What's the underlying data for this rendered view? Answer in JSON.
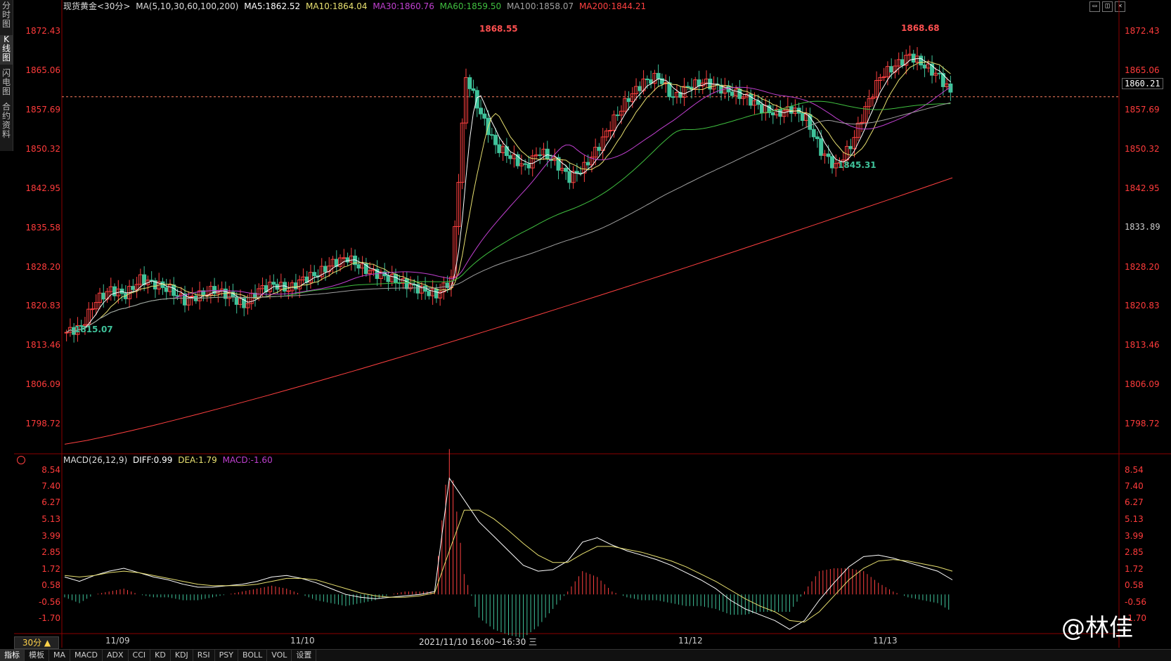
{
  "side_tabs": [
    {
      "label": "分时图"
    },
    {
      "label": "K线图",
      "active": true
    },
    {
      "label": "闪电图"
    },
    {
      "label": "合约资料"
    }
  ],
  "legend": {
    "symbol": "现货黄金<30分>",
    "ma_params": "MA(5,10,30,60,100,200)",
    "ma5": "MA5:1862.52",
    "ma10": "MA10:1864.04",
    "ma30": "MA30:1860.76",
    "ma60": "MA60:1859.50",
    "ma100": "MA100:1858.07",
    "ma200": "MA200:1844.21"
  },
  "colors": {
    "up": "#ff4040",
    "down": "#3fc29a",
    "ma5": "#ffffff",
    "ma10": "#e8e070",
    "ma30": "#c040d0",
    "ma60": "#40c040",
    "ma100": "#a0a0a0",
    "ma200": "#ff4040",
    "axis": "#ff3b3b",
    "grid": "#8b0000"
  },
  "price_axis": {
    "ticks": [
      "1872.43",
      "1865.06",
      "1857.69",
      "1850.32",
      "1842.95",
      "1835.58",
      "1828.20",
      "1820.83",
      "1813.46",
      "1806.09",
      "1798.72"
    ],
    "min": 1794,
    "max": 1876
  },
  "current_price": "1860.21",
  "cursor_price": "1833.89",
  "annotations": {
    "high1": "1868.55",
    "high2": "1868.68",
    "low1": "1815.07",
    "low2": "1845.31"
  },
  "macd": {
    "label": "MACD(26,12,9)",
    "diff": "DIFF:0.99",
    "dea": "DEA:1.79",
    "macd": "MACD:-1.60",
    "ticks": [
      "8.54",
      "7.40",
      "6.27",
      "5.13",
      "3.99",
      "2.85",
      "1.72",
      "0.58",
      "-0.56",
      "-1.70"
    ],
    "min": -2.6,
    "max": 9.0
  },
  "dates": {
    "d1": "11/09",
    "d2": "11/10",
    "cursor": "2021/11/10 16:00~16:30 三",
    "d3": "11/12",
    "d4": "11/13"
  },
  "period": "30分 ▲",
  "bottom_tabs": [
    "指标",
    "模板",
    "MA",
    "MACD",
    "ADX",
    "CCI",
    "KD",
    "KDJ",
    "RSI",
    "PSY",
    "BOLL",
    "VOL",
    "设置"
  ],
  "watermark": "@林佳",
  "chart_data": {
    "type": "candlestick",
    "series": [
      {
        "name": "MA5"
      },
      {
        "name": "MA10"
      },
      {
        "name": "MA30"
      },
      {
        "name": "MA60"
      },
      {
        "name": "MA100"
      },
      {
        "name": "MA200"
      }
    ],
    "ylim": [
      1794,
      1876
    ],
    "close_path": [
      1816,
      1817,
      1822,
      1824,
      1823,
      1826,
      1825,
      1824,
      1822,
      1823,
      1824,
      1823,
      1821,
      1824,
      1825,
      1824,
      1826,
      1827,
      1829,
      1830,
      1828,
      1827,
      1826,
      1825,
      1824,
      1823,
      1826,
      1864,
      1857,
      1851,
      1849,
      1847,
      1850,
      1848,
      1845,
      1847,
      1851,
      1856,
      1860,
      1863,
      1864,
      1860,
      1862,
      1863,
      1862,
      1861,
      1860,
      1858,
      1857,
      1858,
      1856,
      1850,
      1847,
      1851,
      1858,
      1864,
      1866,
      1868,
      1866,
      1864,
      1860
    ],
    "macd_path": [
      1.2,
      0.9,
      1.3,
      1.6,
      1.8,
      1.5,
      1.2,
      1.0,
      0.7,
      0.5,
      0.5,
      0.6,
      0.7,
      0.9,
      1.2,
      1.3,
      1.1,
      0.8,
      0.4,
      0.0,
      -0.2,
      -0.3,
      -0.2,
      -0.1,
      0.0,
      0.2,
      8.0,
      6.5,
      5.0,
      4.0,
      3.0,
      2.0,
      1.6,
      1.7,
      2.3,
      3.6,
      3.9,
      3.4,
      3.0,
      2.7,
      2.4,
      2.0,
      1.5,
      1.0,
      0.4,
      -0.4,
      -1.0,
      -1.4,
      -1.8,
      -2.4,
      -1.8,
      -0.4,
      0.8,
      1.9,
      2.6,
      2.7,
      2.5,
      2.2,
      1.9,
      1.6,
      1.0
    ],
    "dea_path": [
      1.3,
      1.2,
      1.3,
      1.5,
      1.6,
      1.5,
      1.3,
      1.1,
      0.9,
      0.7,
      0.6,
      0.6,
      0.6,
      0.7,
      0.9,
      1.1,
      1.1,
      1.0,
      0.7,
      0.4,
      0.1,
      -0.1,
      -0.2,
      -0.2,
      -0.1,
      0.1,
      3.0,
      5.8,
      5.8,
      5.2,
      4.4,
      3.5,
      2.7,
      2.2,
      2.2,
      2.8,
      3.3,
      3.3,
      3.1,
      2.9,
      2.6,
      2.3,
      1.9,
      1.4,
      0.9,
      0.3,
      -0.3,
      -0.8,
      -1.2,
      -1.8,
      -1.9,
      -1.2,
      -0.1,
      1.0,
      1.8,
      2.3,
      2.4,
      2.3,
      2.1,
      1.9,
      1.6
    ]
  }
}
